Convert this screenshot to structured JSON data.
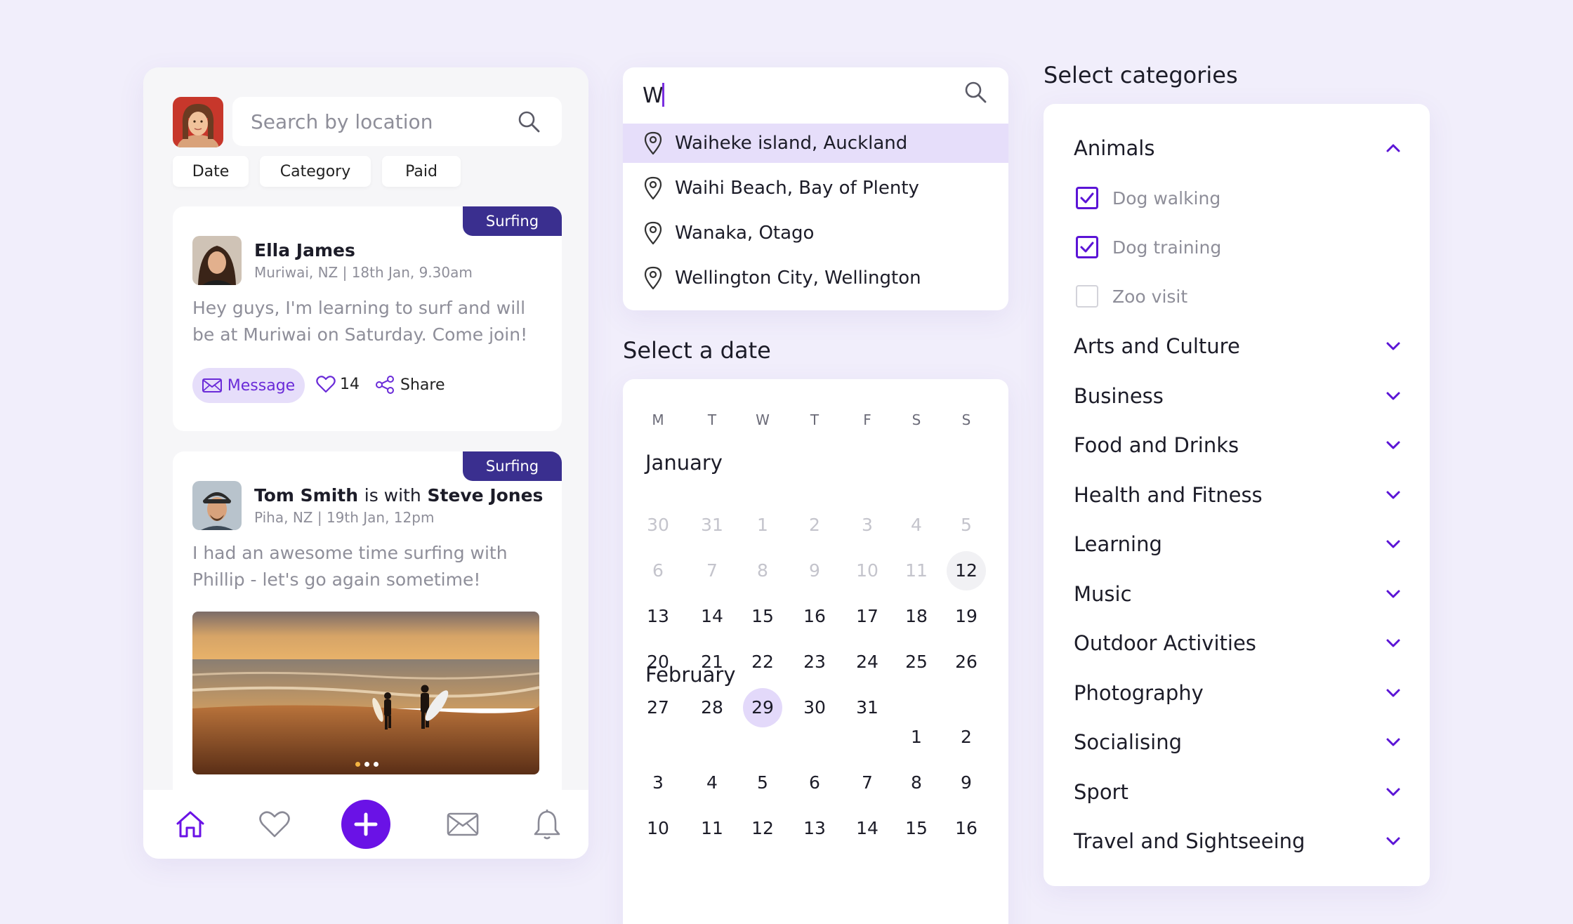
{
  "colors": {
    "accent": "#6a12e6",
    "badge": "#3a2f8f",
    "highlight": "#e6defa",
    "background": "#f1eefb"
  },
  "feed": {
    "search_placeholder": "Search by location",
    "filters": [
      "Date",
      "Category",
      "Paid"
    ],
    "posts": [
      {
        "badge": "Surfing",
        "author": "Ella James",
        "meta": "Muriwai, NZ | 18th Jan, 9.30am",
        "text": "Hey guys, I'm learning to surf and will be at Muriwai on Saturday. Come join!",
        "message_label": "Message",
        "likes": "14",
        "share_label": "Share"
      },
      {
        "badge": "Surfing",
        "author": "Tom Smith",
        "with_word": "is with",
        "with_name": "Steve Jones",
        "meta": "Piha, NZ | 19th Jan, 12pm",
        "text": "I had an awesome time surfing with Phillip - let's go again sometime!"
      }
    ],
    "nav_icons": [
      "home-icon",
      "heart-icon",
      "plus-icon",
      "mail-icon",
      "bell-icon"
    ]
  },
  "location_search": {
    "query": "W",
    "results": [
      "Waiheke island, Auckland",
      "Waihi Beach, Bay of Plenty",
      "Wanaka, Otago",
      "Wellington City, Wellington"
    ]
  },
  "date_picker": {
    "title": "Select a date",
    "weekdays": [
      "M",
      "T",
      "W",
      "T",
      "F",
      "S",
      "S"
    ],
    "months": [
      {
        "name": "January",
        "weeks": [
          [
            "30",
            "31",
            "1",
            "2",
            "3",
            "4",
            "5"
          ],
          [
            "6",
            "7",
            "8",
            "9",
            "10",
            "11",
            "12"
          ],
          [
            "13",
            "14",
            "15",
            "16",
            "17",
            "18",
            "19"
          ],
          [
            "20",
            "21",
            "22",
            "23",
            "24",
            "25",
            "26"
          ],
          [
            "27",
            "28",
            "29",
            "30",
            "31",
            "",
            ""
          ]
        ]
      },
      {
        "name": "February",
        "weeks": [
          [
            "",
            "",
            "",
            "",
            "",
            "1",
            "2"
          ],
          [
            "3",
            "4",
            "5",
            "6",
            "7",
            "8",
            "9"
          ],
          [
            "10",
            "11",
            "12",
            "13",
            "14",
            "15",
            "16"
          ]
        ]
      }
    ],
    "today": "12",
    "selected": "29"
  },
  "categories": {
    "title": "Select categories",
    "expanded": {
      "name": "Animals",
      "options": [
        {
          "label": "Dog walking",
          "checked": true
        },
        {
          "label": "Dog training",
          "checked": true
        },
        {
          "label": "Zoo visit",
          "checked": false
        }
      ]
    },
    "collapsed": [
      "Arts and Culture",
      "Business",
      "Food and Drinks",
      "Health and Fitness",
      "Learning",
      "Music",
      "Outdoor Activities",
      "Photography",
      "Socialising",
      "Sport",
      "Travel and Sightseeing"
    ]
  }
}
